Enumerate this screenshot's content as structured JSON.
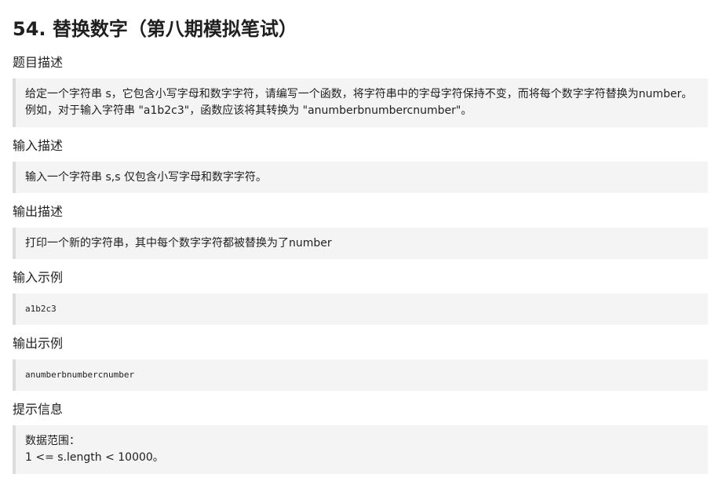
{
  "title": "54. 替换数字（第八期模拟笔试）",
  "sections": {
    "description": {
      "heading": "题目描述",
      "lines": [
        "给定一个字符串 s，它包含小写字母和数字字符，请编写一个函数，将字符串中的字母字符保持不变，而将每个数字字符替换为number。",
        "例如，对于输入字符串 \"a1b2c3\"，函数应该将其转换为 \"anumberbnumbercnumber\"。"
      ]
    },
    "input_desc": {
      "heading": "输入描述",
      "text": "输入一个字符串 s,s 仅包含小写字母和数字字符。"
    },
    "output_desc": {
      "heading": "输出描述",
      "text": "打印一个新的字符串，其中每个数字字符都被替换为了number"
    },
    "input_example": {
      "heading": "输入示例",
      "text": "a1b2c3"
    },
    "output_example": {
      "heading": "输出示例",
      "text": "anumberbnumbercnumber"
    },
    "hint": {
      "heading": "提示信息",
      "lines": [
        "数据范围：",
        "1 <= s.length < 10000。"
      ]
    }
  }
}
